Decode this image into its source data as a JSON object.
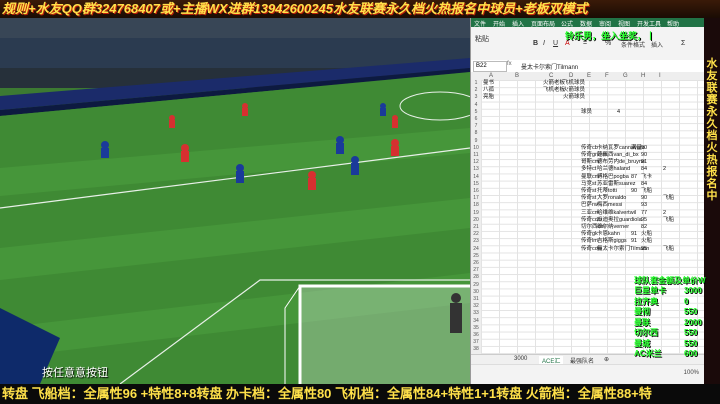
{
  "banner": {
    "top_text": "规则+水友QQ群324768407或+主播WX进群13942600245水友联赛永久档火热报名中球员+老板双模式",
    "bottom_text": "转盘 飞船档：全属性96 +特性8+8转盘 办卡档：全属性80 飞机档：全属性84+特性1+1转盘 火箭档：全属性88+特"
  },
  "game": {
    "press_any_key": "按任意意按钮"
  },
  "excel": {
    "tabs": [
      "文件",
      "开始",
      "插入",
      "页面布局",
      "公式",
      "数据",
      "审阅",
      "视图",
      "开发工具",
      "帮助"
    ],
    "ribbon_buttons": [
      "粘贴",
      "B",
      "I",
      "U",
      "A",
      "=",
      "%",
      "条件格式",
      "插入",
      "Σ"
    ],
    "name_box": "B22",
    "fx_label": "fx",
    "formula_value": "曼太卡尔索门Tilmann",
    "columns": [
      "A",
      "B",
      "C",
      "D",
      "E",
      "F",
      "G",
      "H",
      "I"
    ],
    "rows": [
      "1",
      "2",
      "3",
      "4",
      "5",
      "6",
      "7",
      "8",
      "9",
      "10",
      "11",
      "12",
      "13",
      "14",
      "15",
      "16",
      "17",
      "18",
      "19",
      "20",
      "21",
      "22",
      "23",
      "24",
      "25",
      "26",
      "27",
      "28",
      "29",
      "30",
      "31",
      "32",
      "33",
      "34",
      "35",
      "36",
      "37",
      "38"
    ],
    "top_cells": [
      {
        "col": "A",
        "row": 1,
        "text": "曼书"
      },
      {
        "col": "C",
        "row": 1,
        "text": "火箭老板"
      },
      {
        "col": "D",
        "row": 1,
        "text": "飞机球员"
      },
      {
        "col": "A",
        "row": 2,
        "text": "八孤"
      },
      {
        "col": "C",
        "row": 2,
        "text": "飞机老板"
      },
      {
        "col": "D",
        "row": 2,
        "text": "火箭球员"
      },
      {
        "col": "A",
        "row": 3,
        "text": "亮胎"
      },
      {
        "col": "D",
        "row": 3,
        "text": "火箭球员"
      },
      {
        "col": "E",
        "row": 5,
        "text": "球员"
      },
      {
        "col": "G",
        "row": 5,
        "text": "4"
      }
    ],
    "player_rows": [
      {
        "row": 10,
        "a": "传奇cb",
        "b": "卡纳瓦罗cannavaro",
        "c": "满星",
        "d": "90"
      },
      {
        "row": 11,
        "a": "传奇grimm",
        "b": "范佩西van_di_bx",
        "c": "",
        "d": "90"
      },
      {
        "row": 12,
        "a": "哥斯cm",
        "b": "德布劳内de_bruyne",
        "c": "",
        "d": "91"
      },
      {
        "row": 13,
        "a": "多特ct",
        "b": "哈兰德haland",
        "c": "",
        "d": "84",
        "e": "2"
      },
      {
        "row": 14,
        "a": "曼联cm",
        "b": "博格巴pogba",
        "c": "87",
        "d": "飞卡"
      },
      {
        "row": 15,
        "a": "马竞st",
        "b": "苏亚雷斯suarez",
        "c": "",
        "d": "84"
      },
      {
        "row": 16,
        "a": "传奇st",
        "b": "托蒂totti",
        "c": "90",
        "d": "飞船"
      },
      {
        "row": 17,
        "a": "传奇st",
        "b": "大罗ronaldo",
        "c": "",
        "d": "90",
        "e": "飞船"
      },
      {
        "row": 18,
        "a": "巴萨rw",
        "b": "梅西messi",
        "c": "",
        "d": "93"
      },
      {
        "row": 19,
        "a": "三亚cm",
        "b": "哈维维kalvertwil",
        "c": "",
        "d": "77",
        "e": "2"
      },
      {
        "row": 20,
        "a": "传奇cdm",
        "b": "瓜迪奥拉guardiola",
        "c": "",
        "d": "95",
        "e": "飞船"
      },
      {
        "row": 21,
        "a": "切尔西cm",
        "b": "维尔纳verner",
        "c": "",
        "d": "82"
      },
      {
        "row": 22,
        "a": "传奇gk",
        "b": "卡恩kahn",
        "c": "91",
        "d": "火船"
      },
      {
        "row": 23,
        "a": "传奇lm",
        "b": "吉格斯giggs",
        "c": "91",
        "d": "火船"
      },
      {
        "row": 24,
        "a": "传奇cdm",
        "b": "曼太卡尔索门Tilmann",
        "c": "",
        "d": "95",
        "e": "飞船"
      }
    ],
    "sheet_tabs": [
      "3000",
      "ACE汇",
      "最强队名"
    ],
    "active_sheet_index": 1,
    "zoom": "100%"
  },
  "overlay": {
    "center_top_text": "铃乐男，坐入坐奖，丨",
    "right_strip_text": "水友联赛永久档火热报名中",
    "price_title": "球队套金额及单价W",
    "prices": [
      {
        "name": "巨星单卡",
        "value": "3000"
      },
      {
        "name": "拉齐奥",
        "value": "0"
      },
      {
        "name": "曼彻",
        "value": "550"
      },
      {
        "name": "曼联",
        "value": "2000"
      },
      {
        "name": "切尔西",
        "value": "550"
      },
      {
        "name": "曼城",
        "value": "550"
      },
      {
        "name": "AC米兰",
        "value": "600"
      }
    ]
  },
  "colors": {
    "banner_yellow": "#ffe14a",
    "overlay_green": "#26ff2c",
    "excel_green": "#217346"
  }
}
